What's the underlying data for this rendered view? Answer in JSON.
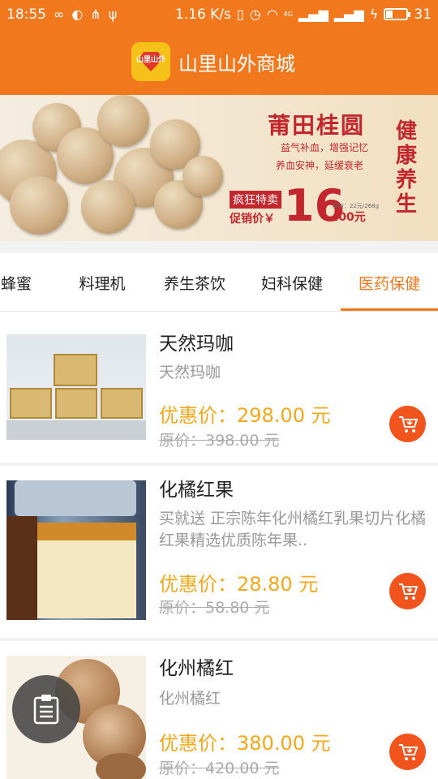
{
  "status_bar": {
    "time": "18:55",
    "network_speed": "1.16 K/s",
    "signal_type": "4G",
    "battery": "31",
    "battery_level": 0.31,
    "icons": [
      "infinity-icon",
      "circle-app-icon",
      "share-icon",
      "usb-icon",
      "vibrate-icon",
      "alarm-icon",
      "wifi-icon",
      "signal-4g-icon",
      "signal-icon",
      "charging-icon",
      "battery-icon"
    ]
  },
  "header": {
    "logo_text": "山里山外",
    "title": "山里山外商城"
  },
  "banner": {
    "title": "莆田桂圆",
    "line1": "益气补血，增强记忆",
    "line2": "养血安神，延缓衰老",
    "tag1": "疯狂特卖",
    "tag2": "促销价￥",
    "price": "16",
    "price_unit": ".00元",
    "spec": "原价：22元/268g",
    "slogan": "健康养生"
  },
  "tabs": [
    {
      "label": "蜂蜜"
    },
    {
      "label": "料理机"
    },
    {
      "label": "养生茶饮"
    },
    {
      "label": "妇科保健"
    },
    {
      "label": "医药保健"
    }
  ],
  "active_tab": "医药保健",
  "products": [
    {
      "name": "天然玛咖",
      "desc": "天然玛咖",
      "price": "优惠价：298.00 元",
      "original": "原价：398.00 元"
    },
    {
      "name": "化橘红果",
      "desc": "买就送 正宗陈年化州橘红乳果切片化橘红果精选优质陈年果..",
      "price": "优惠价：28.80 元",
      "original": "原价：58.80 元"
    },
    {
      "name": "化州橘红",
      "desc": "化州橘红",
      "price": "优惠价：380.00 元",
      "original": "原价：420.00 元"
    }
  ],
  "colors": {
    "brand": "#f2781e",
    "price": "#f2a81d",
    "cart": "#f2541e"
  }
}
